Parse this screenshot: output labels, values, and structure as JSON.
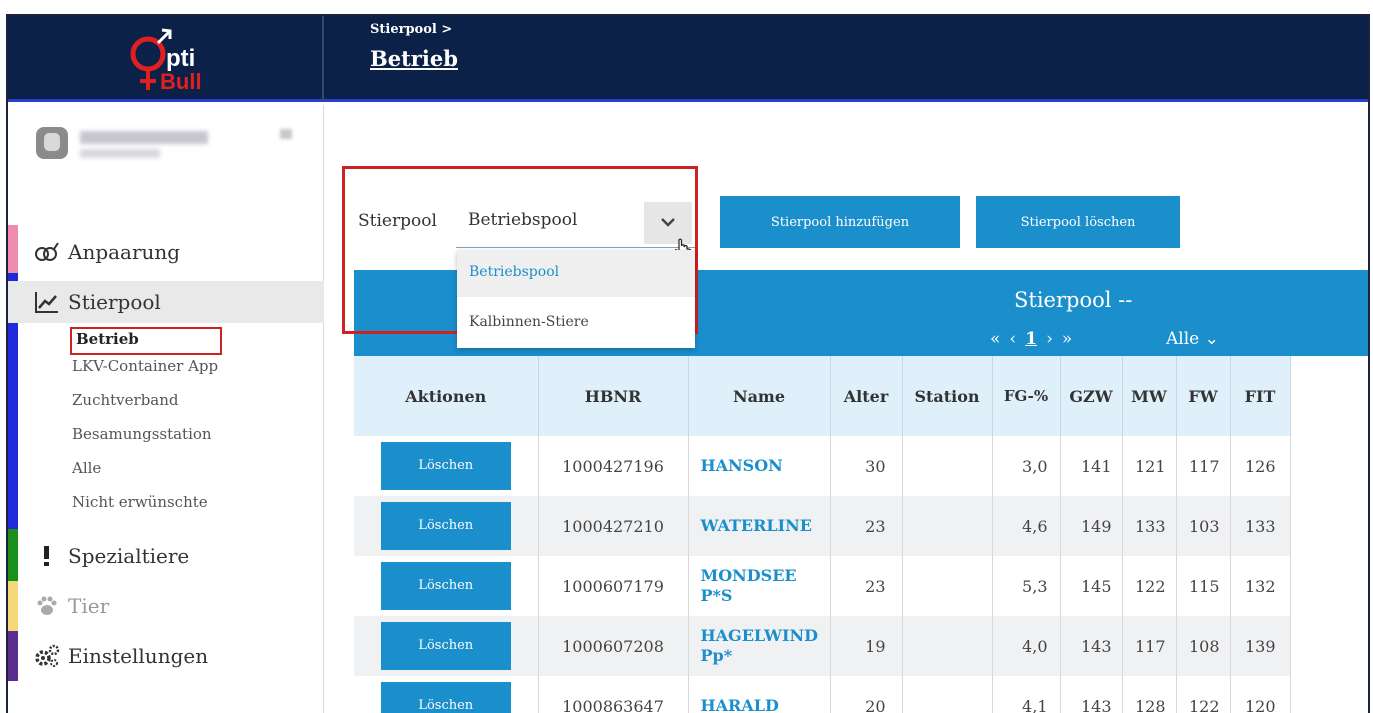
{
  "header": {
    "breadcrumb": "Stierpool >",
    "title": "Betrieb",
    "logo_top": "pti",
    "logo_bottom": "Bull"
  },
  "sidebar": {
    "items": [
      {
        "label": "Anpaarung",
        "icon": "rings-icon",
        "color": "#f08bb0"
      },
      {
        "label": "Stierpool",
        "icon": "trend-chart-icon",
        "color": "#1f2adb"
      },
      {
        "label": "Spezialtiere",
        "icon": "exclamation-icon",
        "color": "#1a8f1a"
      },
      {
        "label": "Tier",
        "icon": "paw-icon",
        "color": "#f5d879"
      },
      {
        "label": "Einstellungen",
        "icon": "gears-icon",
        "color": "#5b2d8f"
      }
    ],
    "subitems": [
      {
        "label": "Betrieb"
      },
      {
        "label": "LKV-Container App"
      },
      {
        "label": "Zuchtverband"
      },
      {
        "label": "Besamungsstation"
      },
      {
        "label": "Alle"
      },
      {
        "label": "Nicht erwünschte"
      }
    ]
  },
  "controls": {
    "label": "Stierpool",
    "selected": "Betriebspool",
    "options": [
      "Betriebspool",
      "Kalbinnen-Stiere"
    ],
    "add_button": "Stierpool hinzufügen",
    "delete_button": "Stierpool löschen"
  },
  "band": {
    "title": "Stierpool --",
    "first": "«",
    "prev": "‹",
    "page": "1",
    "next": "›",
    "last": "»",
    "per_page": "Alle ⌄"
  },
  "table": {
    "headers": [
      "Aktionen",
      "HBNR",
      "Name",
      "Alter",
      "Station",
      "FG-%",
      "GZW",
      "MW",
      "FW",
      "FIT"
    ],
    "rows": [
      {
        "action": "Löschen",
        "hbnr": "1000427196",
        "name": "HANSON",
        "alter": "30",
        "station": "",
        "fg": "3,0",
        "gzw": "141",
        "mw": "121",
        "fw": "117",
        "fit": "126"
      },
      {
        "action": "Löschen",
        "hbnr": "1000427210",
        "name": "WATERLINE",
        "alter": "23",
        "station": "",
        "fg": "4,6",
        "gzw": "149",
        "mw": "133",
        "fw": "103",
        "fit": "133"
      },
      {
        "action": "Löschen",
        "hbnr": "1000607179",
        "name": "MONDSEE P*S",
        "alter": "23",
        "station": "",
        "fg": "5,3",
        "gzw": "145",
        "mw": "122",
        "fw": "115",
        "fit": "132"
      },
      {
        "action": "Löschen",
        "hbnr": "1000607208",
        "name": "HAGELWIND Pp*",
        "alter": "19",
        "station": "",
        "fg": "4,0",
        "gzw": "143",
        "mw": "117",
        "fw": "108",
        "fit": "139"
      },
      {
        "action": "Löschen",
        "hbnr": "1000863647",
        "name": "HARALD",
        "alter": "20",
        "station": "",
        "fg": "4,1",
        "gzw": "143",
        "mw": "128",
        "fw": "122",
        "fit": "120"
      }
    ]
  },
  "colors": {
    "brand_navy": "#0c2148",
    "accent_blue": "#1a8fcc",
    "highlight_red": "#cc2222"
  }
}
